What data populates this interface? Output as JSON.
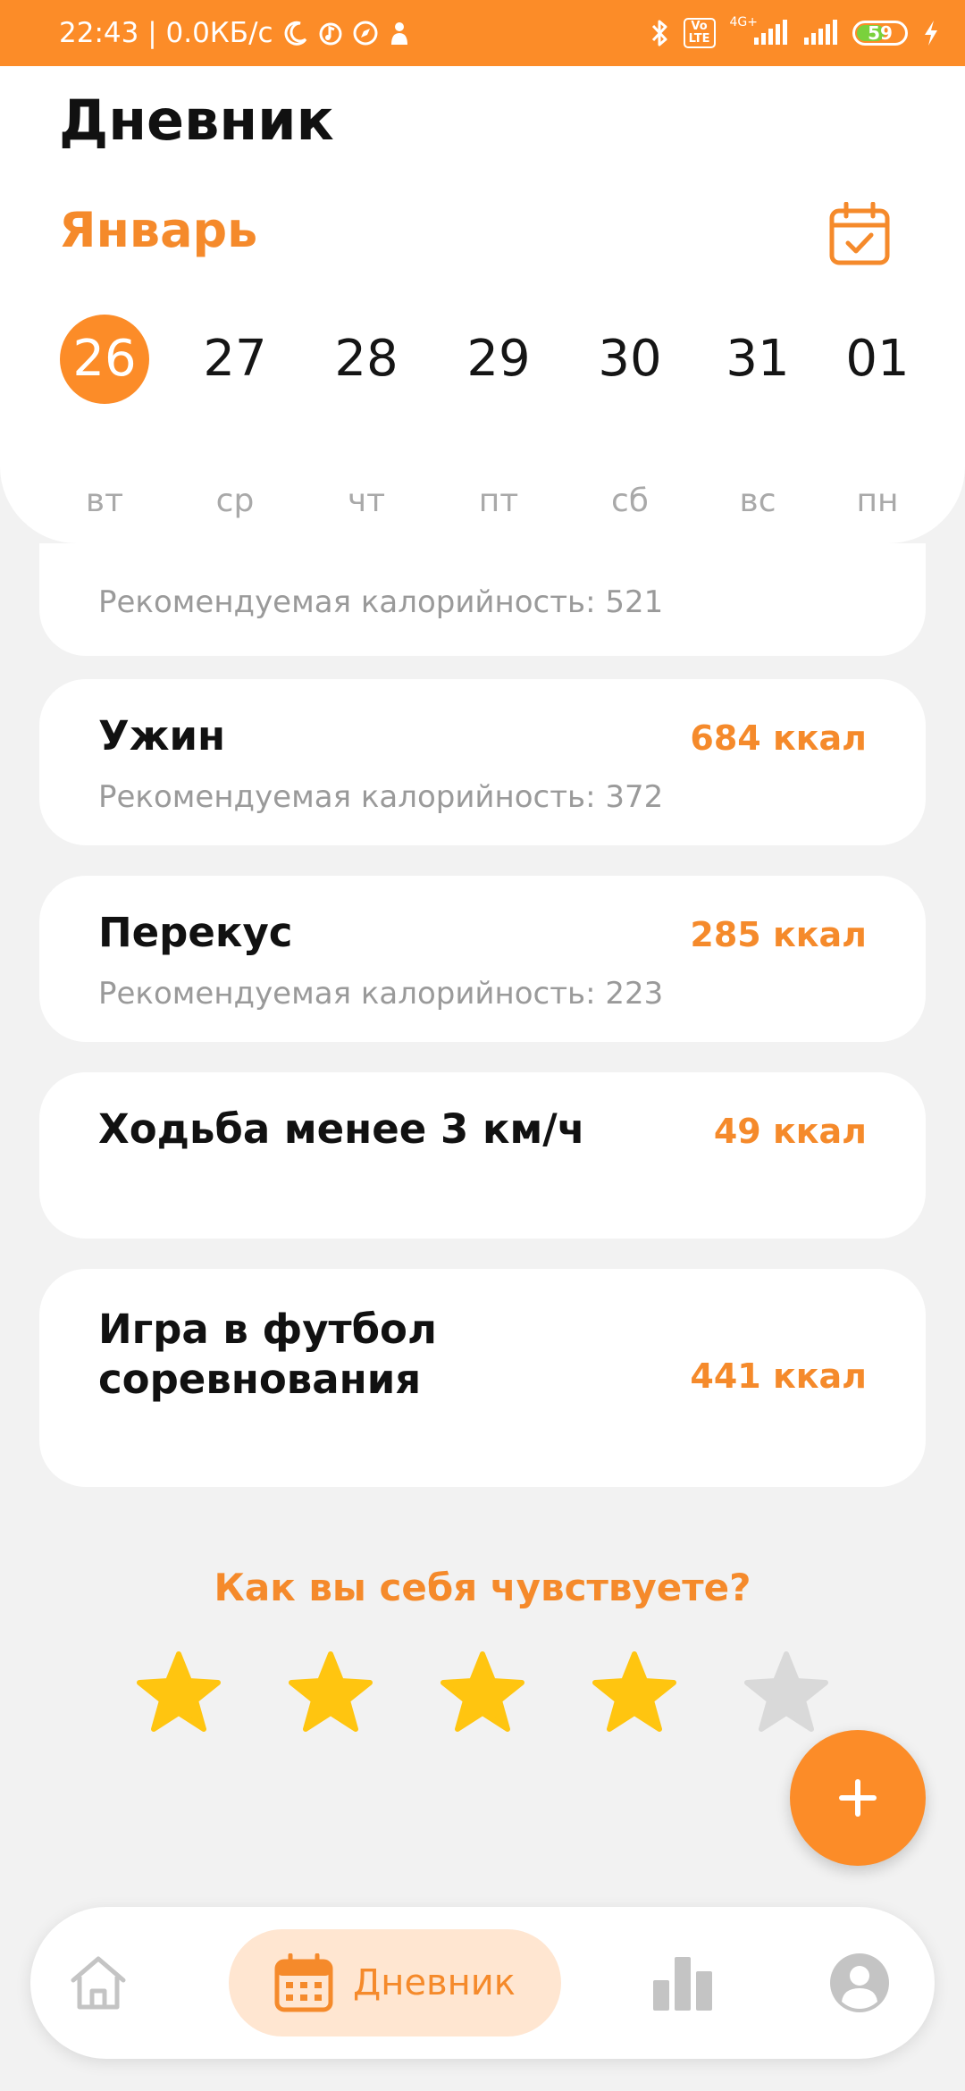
{
  "status_bar": {
    "time_and_speed": "22:43 | 0.0КБ/с",
    "volte_top": "Vo",
    "volte_bottom": "LTE",
    "network": "4G+",
    "battery": "59"
  },
  "header": {
    "title": "Дневник",
    "month": "Январь",
    "calendar_icon": "calendar-check-icon"
  },
  "days": [
    {
      "number": "26",
      "weekday": "вт",
      "selected": true
    },
    {
      "number": "27",
      "weekday": "ср",
      "selected": false
    },
    {
      "number": "28",
      "weekday": "чт",
      "selected": false
    },
    {
      "number": "29",
      "weekday": "пт",
      "selected": false
    },
    {
      "number": "30",
      "weekday": "сб",
      "selected": false
    },
    {
      "number": "31",
      "weekday": "вс",
      "selected": false
    },
    {
      "number": "01",
      "weekday": "пн",
      "selected": false
    }
  ],
  "cards": {
    "partial": {
      "subtitle": "Рекомендуемая калорийность: 521"
    },
    "dinner": {
      "title": "Ужин",
      "kcal": "684 ккал",
      "subtitle": "Рекомендуемая калорийность: 372"
    },
    "snack": {
      "title": "Перекус",
      "kcal": "285 ккал",
      "subtitle": "Рекомендуемая калорийность: 223"
    },
    "walking": {
      "title": "Ходьба менее 3 км/ч",
      "kcal": "49 ккал"
    },
    "football": {
      "title_line1": "Игра в футбол",
      "title_line2": "соревнования",
      "kcal": "441 ккал"
    }
  },
  "mood": {
    "question": "Как вы себя чувствуете?",
    "rating": 4,
    "max": 5
  },
  "fab": {
    "icon": "plus-icon"
  },
  "bottom_nav": {
    "items": [
      {
        "id": "home",
        "icon": "home-icon"
      },
      {
        "id": "diary",
        "icon": "calendar-icon",
        "label": "Дневник",
        "active": true
      },
      {
        "id": "stats",
        "icon": "bar-chart-icon"
      },
      {
        "id": "profile",
        "icon": "profile-icon"
      }
    ]
  },
  "colors": {
    "accent": "#fc8c28",
    "accent_text": "#f58a2b",
    "star_active": "#ffc510",
    "star_inactive": "#d9d9d9",
    "background": "#f2f2f2"
  }
}
